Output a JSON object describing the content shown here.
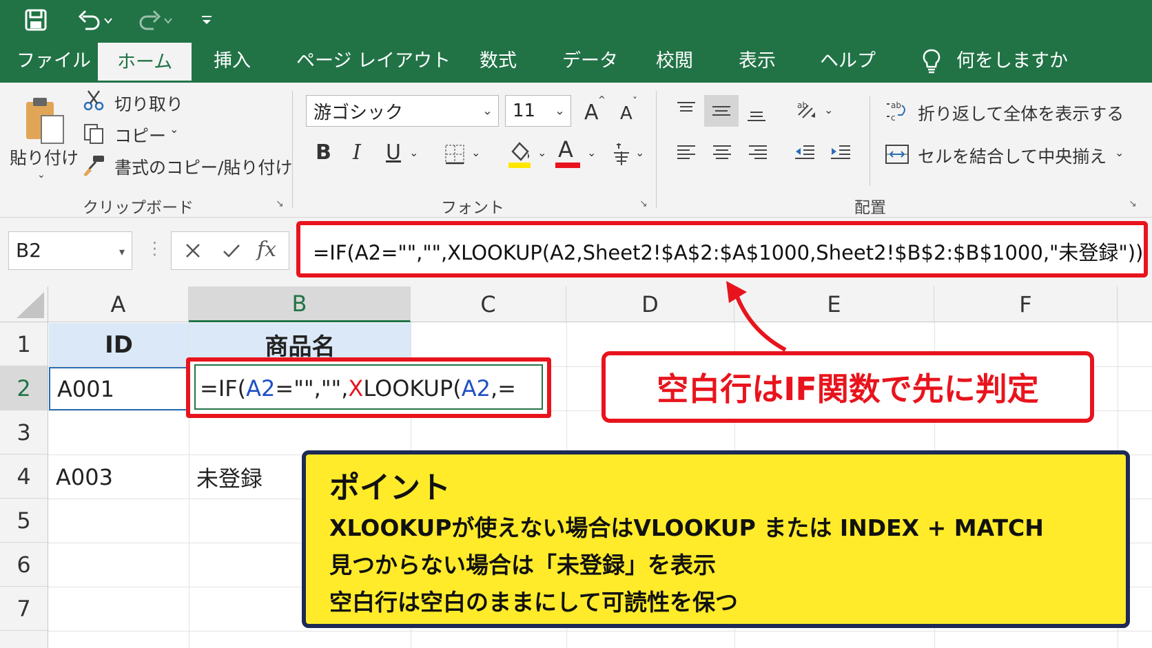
{
  "quick_access": {
    "save_icon": "save-icon",
    "undo_icon": "undo-icon",
    "redo_icon": "redo-icon",
    "customize_icon": "customize-icon"
  },
  "tabs": [
    "ファイル",
    "ホーム",
    "挿入",
    "ページ レイアウト",
    "数式",
    "データ",
    "校閲",
    "表示",
    "ヘルプ"
  ],
  "active_tab": "ホーム",
  "tell_me": "何をしますか",
  "clipboard": {
    "paste": "貼り付け",
    "cut": "切り取り",
    "copy": "コピー",
    "format_painter": "書式のコピー/貼り付け",
    "group": "クリップボード"
  },
  "font": {
    "name": "游ゴシック",
    "size": "11",
    "bold": "B",
    "italic": "I",
    "underline": "U",
    "font_color": "A",
    "grow": "A",
    "shrink": "A",
    "group": "フォント"
  },
  "alignment": {
    "wrap_text": "折り返して全体を表示する",
    "merge_center": "セルを結合して中央揃え",
    "group": "配置"
  },
  "name_box": "B2",
  "formula_bar": {
    "fx": "fx",
    "formula": "=IF(A2=\"\",\"\",XLOOKUP(A2,Sheet2!$A$2:$A$1000,Sheet2!$B$2:$B$1000,\"未登録\"))"
  },
  "columns": [
    "A",
    "B",
    "C",
    "D",
    "E",
    "F"
  ],
  "rows": [
    "1",
    "2",
    "3",
    "4",
    "5",
    "6",
    "7"
  ],
  "cells": {
    "A1": "ID",
    "B1": "商品名",
    "A2": "A001",
    "A4": "A003",
    "B4": "未登録"
  },
  "active_cell_parts": [
    "=IF(",
    "A2",
    "=\"\",\"\",",
    "X",
    "LOOKUP(",
    "A2",
    ",="
  ],
  "callout": "空白行はIF関数で先に判定",
  "point": {
    "title": "ポイント",
    "lines": [
      "XLOOKUPが使えない場合はVLOOKUP または INDEX + MATCH",
      "見つからない場合は「未登録」を表示",
      "空白行は空白のままにして可読性を保つ"
    ]
  },
  "colors": {
    "excel_green": "#217346",
    "accent_red": "#e8141d",
    "point_yellow": "#ffeb2a",
    "point_border": "#1e2a55",
    "ref_blue": "#1f4fc4"
  }
}
